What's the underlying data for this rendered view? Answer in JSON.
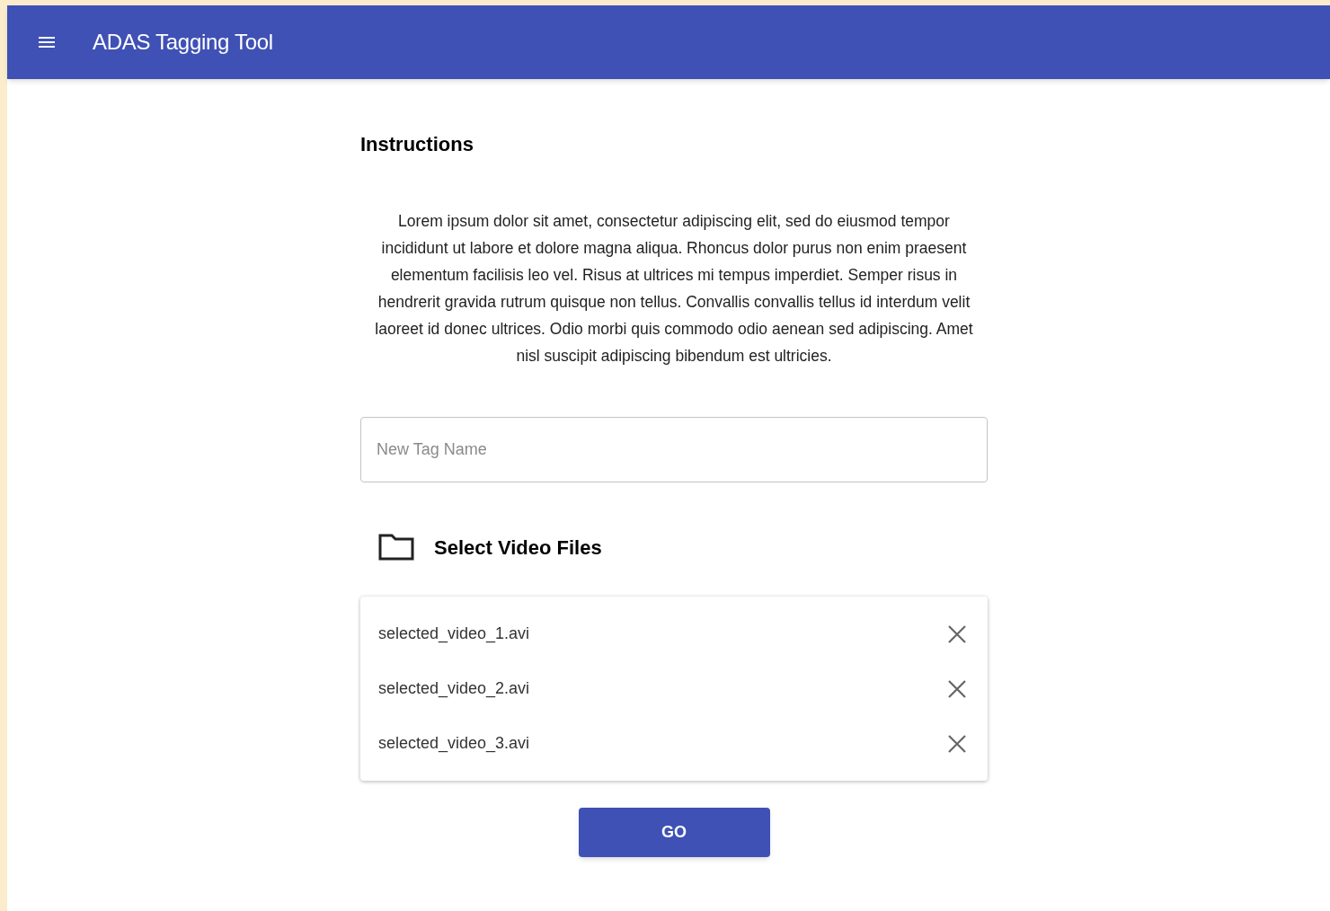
{
  "app_bar": {
    "title": "ADAS Tagging Tool"
  },
  "instructions": {
    "heading": "Instructions",
    "body": "Lorem ipsum dolor sit amet, consectetur adipiscing elit, sed do eiusmod tempor incididunt ut labore et dolore magna aliqua. Rhoncus dolor purus non enim praesent elementum facilisis leo vel. Risus at ultrices mi tempus imperdiet. Semper risus in hendrerit gravida rutrum quisque non tellus. Convallis convallis tellus id interdum velit laoreet id donec ultrices. Odio morbi quis commodo odio aenean sed adipiscing. Amet nisl suscipit adipiscing bibendum est ultricies."
  },
  "tag_field": {
    "placeholder": "New Tag Name"
  },
  "select_files": {
    "label": "Select Video Files"
  },
  "files": [
    {
      "name": "selected_video_1.avi"
    },
    {
      "name": "selected_video_2.avi"
    },
    {
      "name": "selected_video_3.avi"
    }
  ],
  "go_button": {
    "label": "GO"
  }
}
